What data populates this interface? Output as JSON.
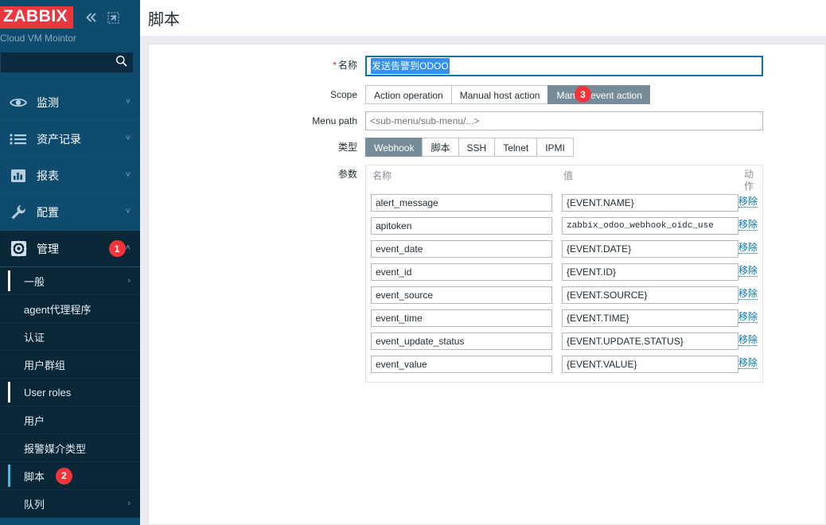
{
  "sidebar": {
    "logo": "ZABBIX",
    "collapse_icon": "chevrons-left-icon",
    "compress_icon": "collapse-arrow-icon",
    "server_name": "Cloud VM Mointor",
    "search": {
      "value": "",
      "placeholder": ""
    },
    "nav": [
      {
        "label": "监测",
        "icon": "eye-icon",
        "chevron": "˅",
        "active": false,
        "badge": ""
      },
      {
        "label": "资产记录",
        "icon": "list-icon",
        "chevron": "˅",
        "active": false,
        "badge": ""
      },
      {
        "label": "报表",
        "icon": "bar-chart-icon",
        "chevron": "˅",
        "active": false,
        "badge": ""
      },
      {
        "label": "配置",
        "icon": "wrench-icon",
        "chevron": "˅",
        "active": false,
        "badge": ""
      },
      {
        "label": "管理",
        "icon": "gear-icon",
        "chevron": "˄",
        "active": true,
        "badge": "1"
      }
    ],
    "submenu": [
      {
        "label": "一般",
        "chevron": "›",
        "state": "selected",
        "badge": ""
      },
      {
        "label": "agent代理程序",
        "chevron": "",
        "state": "",
        "badge": ""
      },
      {
        "label": "认证",
        "chevron": "",
        "state": "",
        "badge": ""
      },
      {
        "label": "用户群组",
        "chevron": "",
        "state": "",
        "badge": ""
      },
      {
        "label": "User roles",
        "chevron": "",
        "state": "selected",
        "badge": ""
      },
      {
        "label": "用户",
        "chevron": "",
        "state": "",
        "badge": ""
      },
      {
        "label": "报警媒介类型",
        "chevron": "",
        "state": "",
        "badge": ""
      },
      {
        "label": "脚本",
        "chevron": "",
        "state": "current",
        "badge": "2"
      },
      {
        "label": "队列",
        "chevron": "›",
        "state": "",
        "badge": ""
      }
    ]
  },
  "header": {
    "title": "脚本"
  },
  "form": {
    "name": {
      "label": "名称",
      "required": "*",
      "value": "发送告警到ODOO",
      "selected": true
    },
    "scope": {
      "label": "Scope",
      "options": [
        "Action operation",
        "Manual host action",
        "Manual event action"
      ],
      "selected": "Manual event action",
      "badge": "3"
    },
    "menu_path": {
      "label": "Menu path",
      "value": "",
      "placeholder": "<sub-menu/sub-menu/...>"
    },
    "type": {
      "label": "类型",
      "options": [
        "Webhook",
        "脚本",
        "SSH",
        "Telnet",
        "IPMI"
      ],
      "selected": "Webhook"
    },
    "parameters": {
      "label": "参数",
      "columns": {
        "name": "名称",
        "value": "值",
        "action": "动作"
      },
      "remove_label": "移除",
      "rows": [
        {
          "name": "alert_message",
          "value": "{EVENT.NAME}",
          "mono": false
        },
        {
          "name": "apitoken",
          "value": "zabbix_odoo_webhook_oidc_use",
          "mono": true
        },
        {
          "name": "event_date",
          "value": "{EVENT.DATE}",
          "mono": false
        },
        {
          "name": "event_id",
          "value": "{EVENT.ID}",
          "mono": false
        },
        {
          "name": "event_source",
          "value": "{EVENT.SOURCE}",
          "mono": false
        },
        {
          "name": "event_time",
          "value": "{EVENT.TIME}",
          "mono": false
        },
        {
          "name": "event_update_status",
          "value": "{EVENT.UPDATE.STATUS}",
          "mono": false
        },
        {
          "name": "event_value",
          "value": "{EVENT.VALUE}",
          "mono": false
        }
      ]
    }
  },
  "colors": {
    "sidebar_bg": "#0f4b6e",
    "submenu_bg": "#0a2738",
    "logo_red": "#e8373d",
    "badge_red": "#f4343a",
    "accent_blue": "#0275b8",
    "selection_blue": "#3390ec",
    "tab_active": "#768d99",
    "content_bg": "#ebebf2"
  }
}
